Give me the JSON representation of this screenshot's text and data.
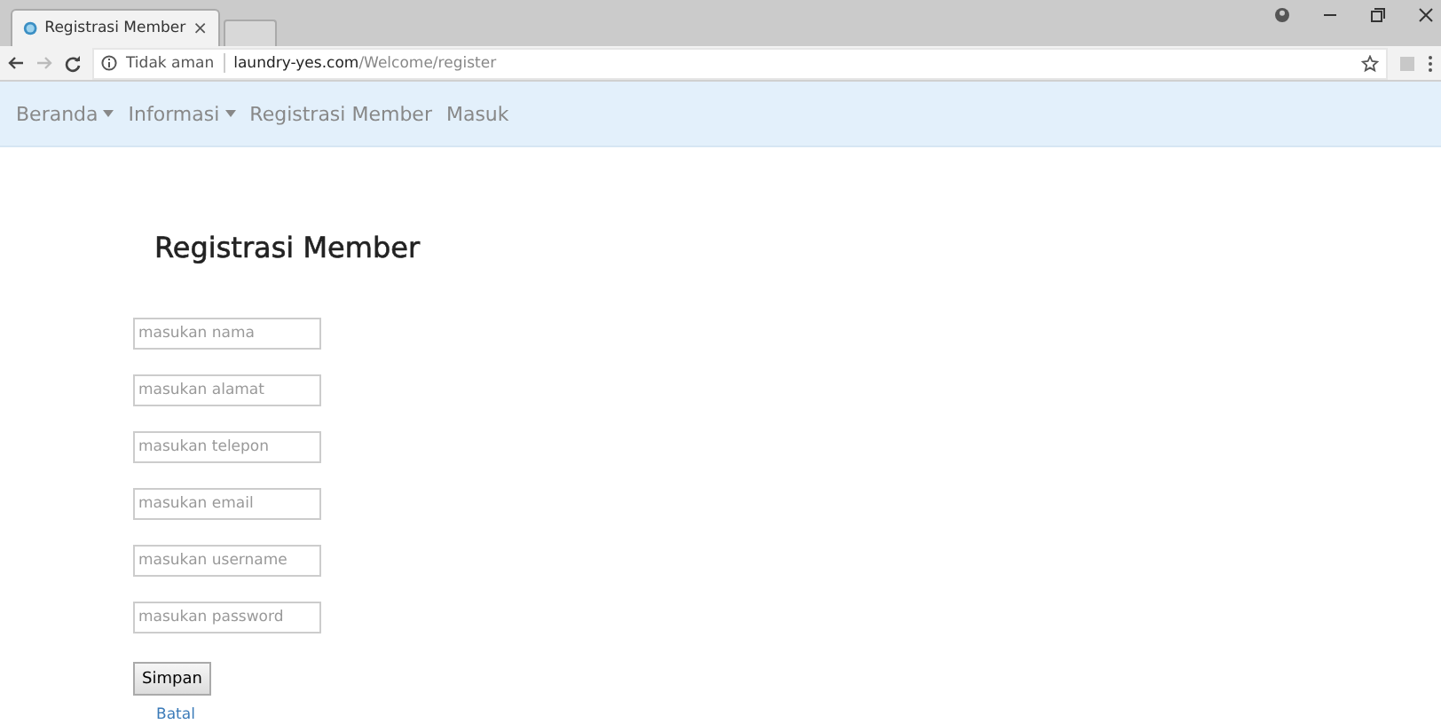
{
  "browser": {
    "tab_title": "Registrasi Member",
    "tab_close": "×",
    "security": "Tidak aman",
    "url_domain": "laundry-yes.com",
    "url_path": "/Welcome/register"
  },
  "nav": [
    {
      "label": "Beranda",
      "dropdown": true
    },
    {
      "label": "Informasi",
      "dropdown": true
    },
    {
      "label": "Registrasi Member",
      "dropdown": false
    },
    {
      "label": "Masuk",
      "dropdown": false
    }
  ],
  "heading": "Registrasi Member",
  "fields": [
    {
      "placeholder": "masukan nama"
    },
    {
      "placeholder": "masukan alamat"
    },
    {
      "placeholder": "masukan telepon"
    },
    {
      "placeholder": "masukan email"
    },
    {
      "placeholder": "masukan username"
    },
    {
      "placeholder": "masukan password"
    }
  ],
  "submit": "Simpan",
  "cancel": "Batal"
}
